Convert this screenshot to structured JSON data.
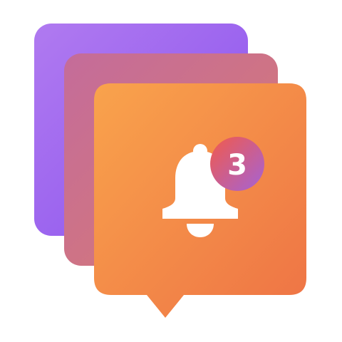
{
  "notification": {
    "badge_count": "3",
    "icon": "bell-icon"
  },
  "colors": {
    "back_card_start": "#B07AF0",
    "back_card_end": "#8A52EE",
    "middle_card_start": "#C46C9A",
    "middle_card_end": "#D87A72",
    "front_card_start": "#F9A34C",
    "front_card_end": "#EE7345",
    "badge_start": "#F25A4A",
    "badge_end": "#A463D6",
    "bell": "#FFFFFF",
    "badge_text": "#FFFFFF"
  }
}
